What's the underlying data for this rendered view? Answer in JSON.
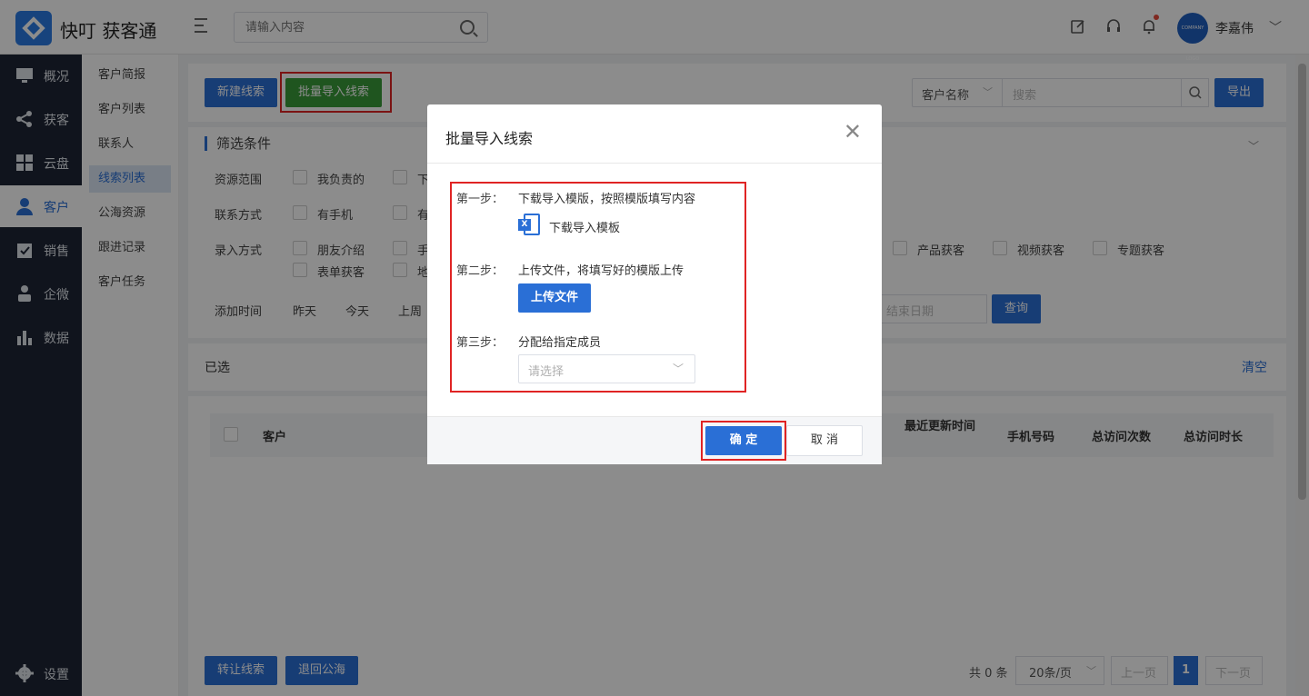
{
  "header": {
    "brand": "快叮 获客通",
    "search_placeholder": "请输入内容",
    "username": "李嘉伟",
    "avatar_text": "COMPANY LOGO"
  },
  "sidebar": {
    "items": [
      {
        "label": "概况",
        "icon": "monitor-icon"
      },
      {
        "label": "获客",
        "icon": "share-icon"
      },
      {
        "label": "云盘",
        "icon": "grid-icon"
      },
      {
        "label": "客户",
        "icon": "user-icon",
        "active": true
      },
      {
        "label": "销售",
        "icon": "clipboard-check-icon"
      },
      {
        "label": "企微",
        "icon": "person-icon"
      },
      {
        "label": "数据",
        "icon": "bar-chart-icon"
      },
      {
        "label": "设置",
        "icon": "gear-icon"
      }
    ]
  },
  "submenu": {
    "items": [
      {
        "label": "客户简报"
      },
      {
        "label": "客户列表"
      },
      {
        "label": "联系人"
      },
      {
        "label": "线索列表",
        "active": true
      },
      {
        "label": "公海资源"
      },
      {
        "label": "跟进记录"
      },
      {
        "label": "客户任务"
      }
    ]
  },
  "toolbar": {
    "new_lead": "新建线索",
    "batch_import": "批量导入线索",
    "field_select": "客户名称",
    "search_placeholder": "搜索",
    "export": "导出"
  },
  "filter": {
    "title": "筛选条件",
    "resource_label": "资源范围",
    "resource_options": [
      "我负责的",
      "下"
    ],
    "contact_label": "联系方式",
    "contact_options": [
      "有手机",
      "有"
    ],
    "entry_label": "录入方式",
    "entry_options_row1": [
      "朋友介绍",
      "手"
    ],
    "entry_options_row1_right": [
      "产品获客",
      "视频获客",
      "专题获客"
    ],
    "entry_options_row2": [
      "表单获客",
      "地"
    ],
    "time_label": "添加时间",
    "time_options": [
      "昨天",
      "今天",
      "上周"
    ],
    "end_date_placeholder": "结束日期",
    "query": "查询"
  },
  "selected": {
    "label": "已选",
    "clear": "清空"
  },
  "table": {
    "headers": [
      "客户",
      "最近更新时间",
      "手机号码",
      "总访问次数",
      "总访问时长"
    ]
  },
  "footer": {
    "transfer": "转让线索",
    "return_pool": "退回公海",
    "total": "共 0 条",
    "page_size": "20条/页",
    "prev": "上一页",
    "page": "1",
    "next": "下一页"
  },
  "dialog": {
    "title": "批量导入线索",
    "step1_label": "第一步：",
    "step1_text": "下载导入模版，按照模版填写内容",
    "download_link": "下载导入模板",
    "step2_label": "第二步：",
    "step2_text": "上传文件，将填写好的模版上传",
    "upload_button": "上传文件",
    "step3_label": "第三步：",
    "step3_text": "分配给指定成员",
    "member_placeholder": "请选择",
    "confirm": "确 定",
    "cancel": "取 消"
  }
}
